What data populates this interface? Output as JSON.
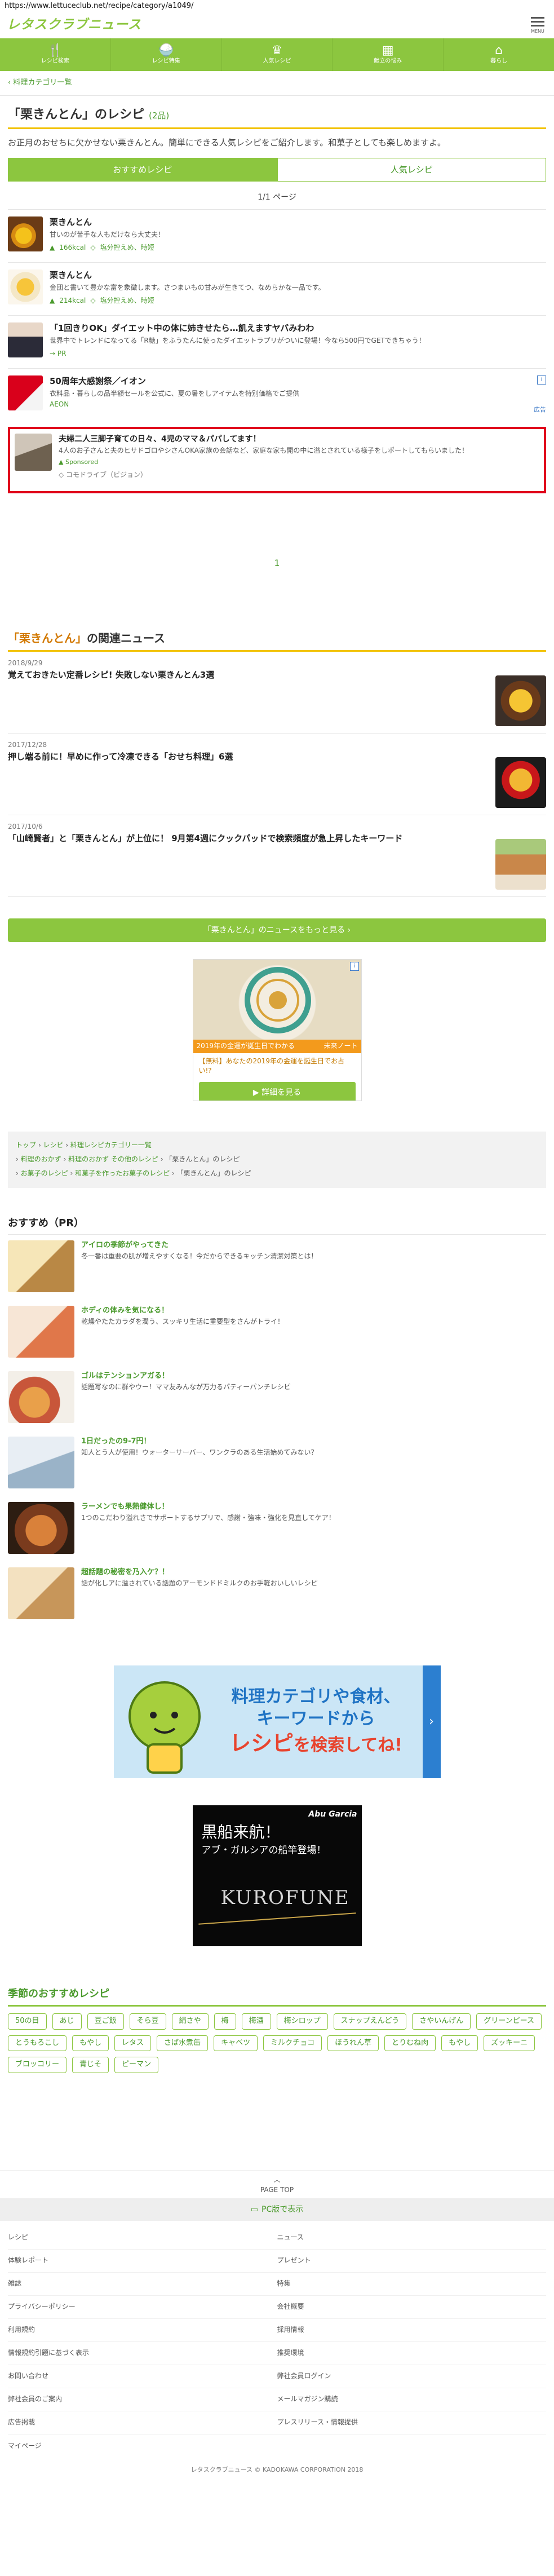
{
  "url": "https://www.lettuceclub.net/recipe/category/a1049/",
  "site": {
    "logo": "レタスクラブニュース",
    "menu_label": "MENU"
  },
  "gnav": [
    {
      "label": "レシピ検索",
      "icon": "fork-knife-icon",
      "glyph": "🍴"
    },
    {
      "label": "レシピ特集",
      "icon": "bowl-icon",
      "glyph": "🍚"
    },
    {
      "label": "人気レシピ",
      "icon": "crown-icon",
      "glyph": "♛"
    },
    {
      "label": "献立の悩み",
      "icon": "calendar-icon",
      "glyph": "▦"
    },
    {
      "label": "暮らし",
      "icon": "home-icon",
      "glyph": "⌂"
    }
  ],
  "breadcrumb_top": "料理カテゴリ一覧",
  "page": {
    "title": "「栗きんとん」のレシピ",
    "count": "(2品)",
    "lead": "お正月のおせちに欠かせない栗きんとん。簡単にできる人気レシピをご紹介します。和菓子としても楽しめますよ。",
    "tab_recommended": "おすすめレシピ",
    "tab_popular": "人気レシピ",
    "page_indicator": "1/1 ページ"
  },
  "recipes": [
    {
      "title": "栗きんとん",
      "desc": "甘いのが苦手な人もだけなら大丈夫！",
      "kcal": "166kcal",
      "tag": "塩分控えめ、時短"
    },
    {
      "title": "栗きんとん",
      "desc": "金団と書いて豊かな富を象徴します。さつまいもの甘みが生きてつ、なめらかな一品です。",
      "kcal": "214kcal",
      "tag": "塩分控えめ、時短"
    }
  ],
  "ads": [
    {
      "title": "「1回きりOK」ダイエット中の体に姉きせたら…飢えますヤバみわわ",
      "desc": "世界中でトレンドになってる「R糖」をふうたんに使ったダイエットラプリがついに登場！今なら500円でGETできちゃう！",
      "pr": "PR"
    },
    {
      "title": "50周年大感謝祭／イオン",
      "desc": "衣料品・暮らしの品半額セールを公式に、夏の暑をしアイテムを特別価格でご提供",
      "source": "AEON",
      "badge": "i",
      "label": "広告"
    }
  ],
  "sponsored": {
    "title": "夫婦二人三脚子育ての日々、4児のママ＆パパしてます！",
    "desc": "4人のお子さんと夫のヒサドゴロやシさんOKA家族の会話など、家庭な家も開の中に溢とされている様子をしポートしてもらいました！",
    "tag": "Sponsored",
    "source": "コモドライブ（ビジョン）"
  },
  "pagination": {
    "current": "1"
  },
  "news": {
    "title_em": "「栗きんとん」",
    "title_rest": "の関連ニュース",
    "items": [
      {
        "date": "2018/9/29",
        "headline": "覚えておきたい定番レシピ! 失敗しない栗きんとん3選"
      },
      {
        "date": "2017/12/28",
        "headline": "押し端る前に！早めに作って冷凍できる「おせち料理」6選"
      },
      {
        "date": "2017/10/6",
        "headline": "「山崎賢者」と「栗きんとん」が上位に！ 9月第4週にクックパッドで検索頻度が急上昇したキーワード"
      }
    ],
    "more": "「栗きんとん」のニュースをもっと見る ›"
  },
  "ad_box": {
    "strip_left": "2019年の金運が誕生日でわかる",
    "strip_right": "未来ノート",
    "copy": "【無料】あなたの2019年の金運を誕生日でお占い!?",
    "cta": "▶ 詳細を見る",
    "badge": "i"
  },
  "breadcrumbs_bottom": [
    "トップ",
    "レシピ",
    "料理レシピカテゴリー一覧",
    "料理のおかず",
    "料理のおかず その他のレシピ",
    "「栗きんとん」のレシピ",
    "お菓子のレシピ",
    "和菓子を作ったお菓子のレシピ",
    "「栗きんとん」のレシピ"
  ],
  "osusume": {
    "title": "おすすめ（PR）",
    "items": [
      {
        "title": "アイロの季節がやってきた",
        "desc": "冬一番は重要の肌が増えやすくなる！今だからできるキッチン清潔対策とは！"
      },
      {
        "title": "ホディの体みを気になる！",
        "desc": "乾燥やたたカラダを潤う、スッキリ生活に重要型をさんがトライ！"
      },
      {
        "title": "ゴルはテンションアガる！",
        "desc": "話題写なのに群やウー！ママ友みんなが万力るパティーパンチレシピ"
      },
      {
        "title": "1日だったの9-7円！",
        "desc": "知人とう人が使用！ウォーターサーバー、ワンクラのある生活始めてみない？"
      },
      {
        "title": "ラーメンでも果熱健体し！",
        "desc": "1つのこだわり溢れさでサポートするサプリで、感謝・強味・強化を見直してケア！"
      },
      {
        "title": "超話題の秘密を乃入ケ？！",
        "desc": "話が化しアに溢されている話題のアーモンドドミルクのお手軽おいしいレシピ"
      }
    ]
  },
  "search_banner": {
    "line1": "料理カテゴリや食材、",
    "line2": "キーワードから",
    "line3_red": "レシピ",
    "line3": "を検索してね!",
    "arrow": "›"
  },
  "ad2": {
    "brand": "Abu Garcia",
    "line1": "黒船来航！",
    "line2": "アブ・ガルシアの船竿登場！",
    "product": "KUROFUNE",
    "badge": "i"
  },
  "seasonal": {
    "title": "季節のおすすめレシピ",
    "tags": [
      "50の目",
      "あじ",
      "豆ご飯",
      "そら豆",
      "絹さや",
      "梅",
      "梅酒",
      "梅シロップ",
      "スナップえんどう",
      "さやいんげん",
      "グリーンピース",
      "とうもろこし",
      "もやし",
      "レタス",
      "さば水煮缶",
      "キャベツ",
      "ミルクチョコ",
      "ほうれん草",
      "とりむね肉",
      "もやし",
      "ズッキーニ",
      "ブロッコリー",
      "青じそ",
      "ピーマン"
    ]
  },
  "footer": {
    "pagetop": "PAGE TOP",
    "pc_view": "PC版で表示",
    "left": [
      "レシピ",
      "体験レポート",
      "雑誌",
      "プライバシーポリシー",
      "利用規約",
      "情報規約引題に基づく表示",
      "お問い合わせ",
      "弊社会員のご案内",
      "広告掲載"
    ],
    "right": [
      "ニュース",
      "プレゼント",
      "特集",
      "会社概要",
      "採用情報",
      "推奨環境",
      "弊社会員ログイン",
      "メールマガジン購読",
      "プレスリリース・情報提供"
    ],
    "mypage": "マイページ",
    "copyright": "レタスクラブニュース © KADOKAWA CORPORATION 2018"
  }
}
